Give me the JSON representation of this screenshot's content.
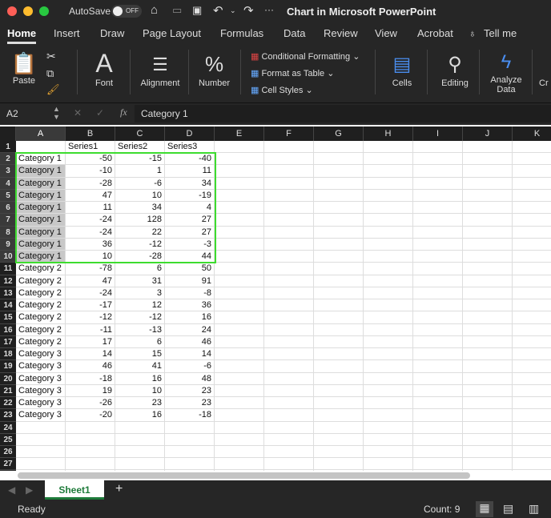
{
  "window": {
    "title": "Chart in Microsoft PowerPoint",
    "autosave_label": "AutoSave",
    "autosave_state": "OFF"
  },
  "tabs": [
    "Home",
    "Insert",
    "Draw",
    "Page Layout",
    "Formulas",
    "Data",
    "Review",
    "View",
    "Acrobat",
    "Tell me"
  ],
  "ribbon": {
    "paste": "Paste",
    "font": "Font",
    "alignment": "Alignment",
    "number": "Number",
    "conditional_formatting": "Conditional Formatting",
    "format_as_table": "Format as Table",
    "cell_styles": "Cell Styles",
    "cells": "Cells",
    "editing": "Editing",
    "analyze_data": "Analyze Data",
    "create": "Cr"
  },
  "formula_bar": {
    "name_box": "A2",
    "fx": "fx",
    "value": "Category 1"
  },
  "columns": [
    "A",
    "B",
    "C",
    "D",
    "E",
    "F",
    "G",
    "H",
    "I",
    "J",
    "K"
  ],
  "rows": [
    [
      "",
      "Series1",
      "Series2",
      "Series3"
    ],
    [
      "Category 1",
      -50,
      -15,
      -40
    ],
    [
      "Category 1",
      -10,
      1,
      11
    ],
    [
      "Category 1",
      -28,
      -6,
      34
    ],
    [
      "Category 1",
      47,
      10,
      -19
    ],
    [
      "Category 1",
      11,
      34,
      4
    ],
    [
      "Category 1",
      -24,
      128,
      27
    ],
    [
      "Category 1",
      -24,
      22,
      27
    ],
    [
      "Category 1",
      36,
      -12,
      -3
    ],
    [
      "Category 1",
      10,
      -28,
      44
    ],
    [
      "Category 2",
      -78,
      6,
      50
    ],
    [
      "Category 2",
      47,
      31,
      91
    ],
    [
      "Category 2",
      -24,
      3,
      -8
    ],
    [
      "Category 2",
      -17,
      12,
      36
    ],
    [
      "Category 2",
      -12,
      -12,
      16
    ],
    [
      "Category 2",
      -11,
      -13,
      24
    ],
    [
      "Category 2",
      17,
      6,
      46
    ],
    [
      "Category 3",
      14,
      15,
      14
    ],
    [
      "Category 3",
      46,
      41,
      -6
    ],
    [
      "Category 3",
      -18,
      16,
      48
    ],
    [
      "Category 3",
      19,
      10,
      23
    ],
    [
      "Category 3",
      -26,
      23,
      23
    ],
    [
      "Category 3",
      -20,
      16,
      -18
    ],
    [],
    [],
    [],
    [],
    []
  ],
  "sheets": [
    "Sheet1"
  ],
  "status": {
    "ready": "Ready",
    "count": "Count: 9"
  },
  "colors": {
    "selection": "#3ddc2f",
    "selected_fill": "#c8c8c8"
  }
}
